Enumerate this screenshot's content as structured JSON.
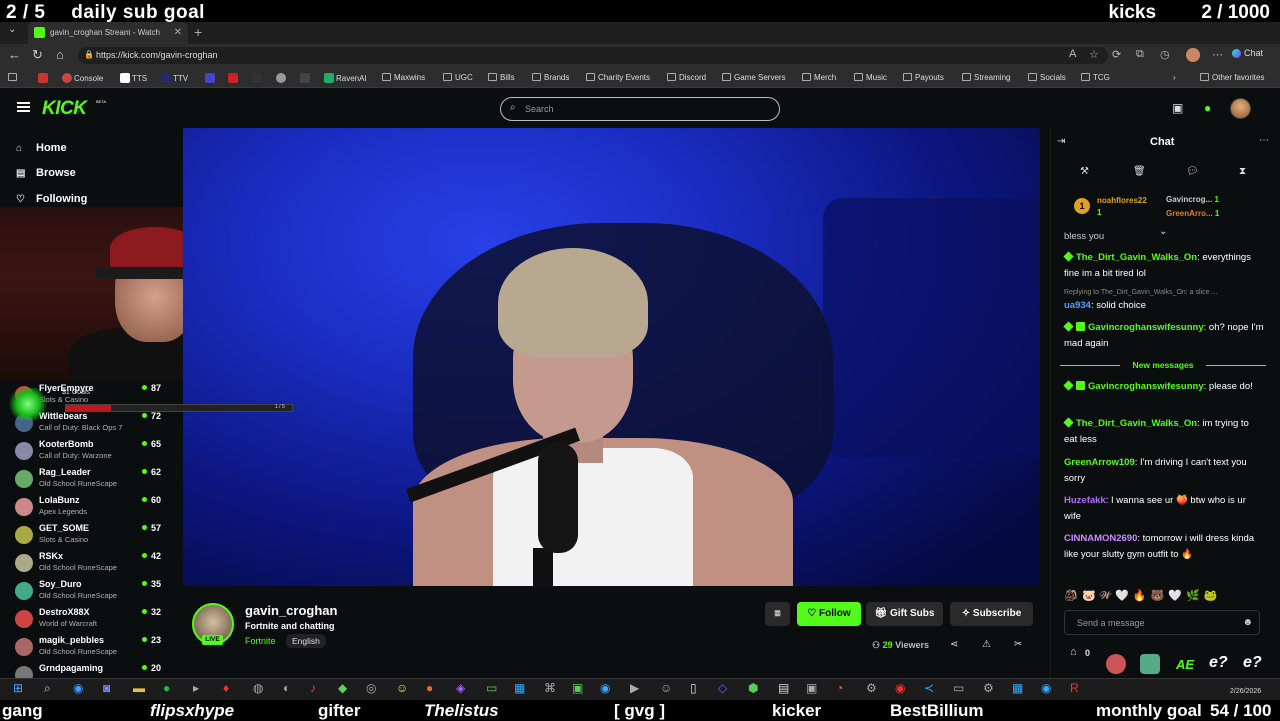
{
  "overlay_top": {
    "sub_goal_current": "2",
    "sub_goal_total": "/ 5",
    "sub_goal_label": "daily sub goal",
    "kicks_label": "kicks",
    "kicks_progress": "2 / 1000"
  },
  "browser": {
    "tab_title": "gavin_croghan Stream - Watch",
    "url": "https://kick.com/gavin-croghan",
    "chat_button": "Chat",
    "bookmarks": [
      "Console",
      "TTS",
      "TTV",
      "RavenAI",
      "Maxwins",
      "UGC",
      "Bills",
      "Brands",
      "Charity Events",
      "Discord",
      "Game Servers",
      "Merch",
      "Music",
      "Payouts",
      "Streaming",
      "Socials",
      "TCG"
    ],
    "other_favorites": "Other favorites"
  },
  "header": {
    "logo": "KICK",
    "logo_badge": "BETA",
    "search_placeholder": "Search"
  },
  "sidebar": {
    "nav": [
      {
        "label": "Home",
        "icon": "home-icon"
      },
      {
        "label": "Browse",
        "icon": "browse-icon"
      },
      {
        "label": "Following",
        "icon": "heart-icon"
      }
    ],
    "channels": [
      {
        "name": "FlyerEmpyre",
        "game": "Slots & Casino",
        "viewers": "87",
        "color": "#d44"
      },
      {
        "name": "Wittlebears",
        "game": "Call of Duty: Black Ops 7",
        "viewers": "72",
        "color": "#468"
      },
      {
        "name": "KooterBomb",
        "game": "Call of Duty: Warzone",
        "viewers": "65",
        "color": "#88a"
      },
      {
        "name": "Rag_Leader",
        "game": "Old School RuneScape",
        "viewers": "62",
        "color": "#6a6"
      },
      {
        "name": "LolaBunz",
        "game": "Apex Legends",
        "viewers": "60",
        "color": "#c88"
      },
      {
        "name": "GET_SOME",
        "game": "Slots & Casino",
        "viewers": "57",
        "color": "#aa4"
      },
      {
        "name": "RSKx",
        "game": "Old School RuneScape",
        "viewers": "42",
        "color": "#aa8"
      },
      {
        "name": "Soy_Duro",
        "game": "Old School RuneScape",
        "viewers": "35",
        "color": "#4a8"
      },
      {
        "name": "DestroX88X",
        "game": "World of Warcraft",
        "viewers": "32",
        "color": "#c44"
      },
      {
        "name": "magik_pebbles",
        "game": "Old School RuneScape",
        "viewers": "23",
        "color": "#a66"
      },
      {
        "name": "Grndpagaming",
        "game": "",
        "viewers": "20",
        "color": "#777"
      }
    ]
  },
  "goal_overlay": {
    "title": "$1 Goals",
    "progress_text": "1 / 5",
    "progress_fraction": 0.2
  },
  "stream": {
    "streamer": "gavin_croghan",
    "title": "Fortnite and chatting",
    "category": "Fortnite",
    "language": "English",
    "live_label": "LIVE",
    "viewers": "29",
    "viewers_label": "Viewers",
    "follow_label": "Follow",
    "gift_label": "Gift Subs",
    "subscribe_label": "Subscribe"
  },
  "chat": {
    "title": "Chat",
    "pinned": [
      {
        "rank": "1",
        "name": "noahflores22",
        "count": "1"
      },
      {
        "name": "Gavincrog...",
        "count": "1"
      },
      {
        "name": "GreenArro...",
        "count": "1"
      }
    ],
    "partial_line": "bless you",
    "messages": [
      {
        "user": "The_Dirt_Gavin_Walks_On",
        "color": "#53fc18",
        "text": "everythings fine im a bit tired lol"
      },
      {
        "reply": "Replying to The_Dirt_Gavin_Walks_On: a slice ...",
        "user": "ua934",
        "color": "#4aa3ff",
        "text": "solid choice"
      },
      {
        "user": "Gavincroghanswifesunny",
        "color": "#53fc18",
        "text": "oh? nope I'm mad again"
      },
      {
        "user": "Gavincroghanswifesunny",
        "color": "#53fc18",
        "text": "please do!"
      },
      {
        "user": "The_Dirt_Gavin_Walks_On",
        "color": "#53fc18",
        "text": "im trying to eat less"
      },
      {
        "user": "GreenArrow109",
        "color": "#53fc18",
        "text": "I'm driving I can't text you sorry"
      },
      {
        "user": "Huzefakk",
        "color": "#b06bff",
        "text": "I wanna see ur 🍑 btw who is ur wife"
      },
      {
        "user": "CINNAMON2690",
        "color": "#c78bff",
        "text": "tomorrow i will dress kinda like your slutty gym outfit to 🔥"
      }
    ],
    "new_messages_label": "New messages",
    "input_placeholder": "Send a message",
    "points": "0"
  },
  "overlay_emotes": [
    "AE",
    "e?",
    "e?"
  ],
  "taskbar": {
    "date": "2/26/2026"
  },
  "ticker": [
    "gang",
    "flipsxhype",
    "gifter",
    "Thelistus",
    "[ gvg ]",
    "kicker",
    "BestBillium",
    "monthly goal",
    "54 / 100"
  ],
  "colors": {
    "kick_green": "#53fc18",
    "background": "#0b0e0f"
  }
}
